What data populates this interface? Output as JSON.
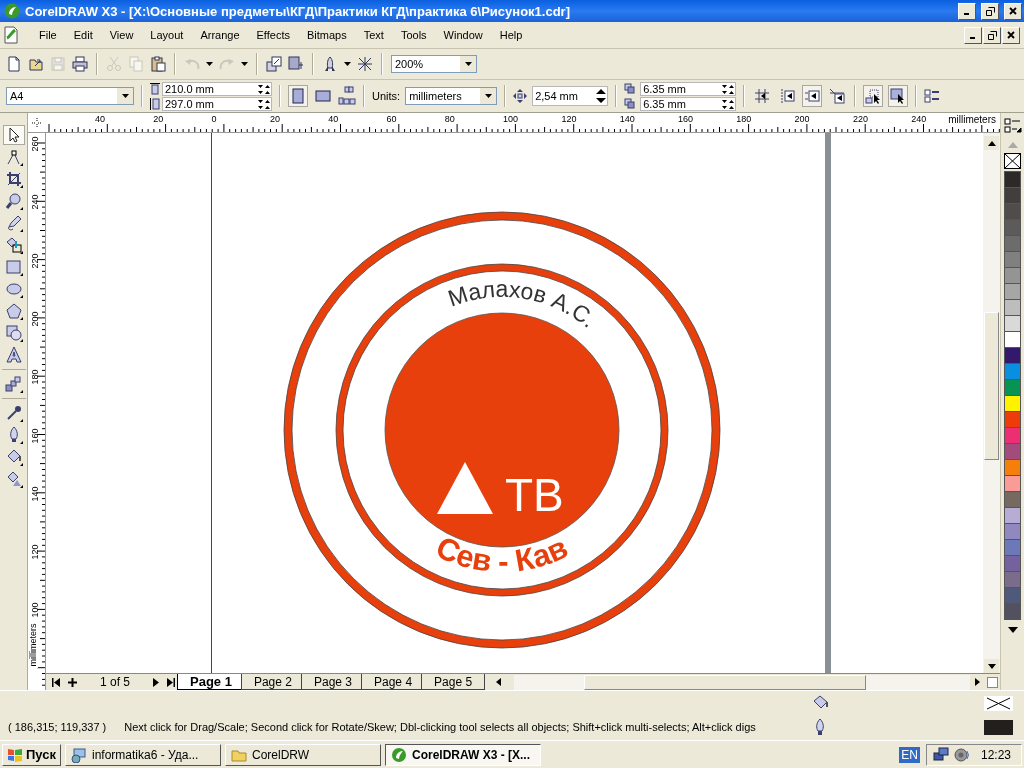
{
  "window": {
    "title": "CorelDRAW X3 - [X:\\Основные предметы\\КГД\\Практики КГД\\практика 6\\Рисунок1.cdr]"
  },
  "menu": [
    "File",
    "Edit",
    "View",
    "Layout",
    "Arrange",
    "Effects",
    "Bitmaps",
    "Text",
    "Tools",
    "Window",
    "Help"
  ],
  "standard_toolbar": [
    {
      "kind": "new",
      "disabled": false
    },
    {
      "kind": "open",
      "disabled": false
    },
    {
      "kind": "save",
      "disabled": true
    },
    {
      "kind": "print",
      "disabled": false
    },
    {
      "kind": "cut",
      "disabled": true
    },
    {
      "kind": "copy",
      "disabled": true
    },
    {
      "kind": "paste",
      "disabled": false
    },
    {
      "kind": "undo",
      "disabled": true
    },
    {
      "kind": "redo",
      "disabled": true
    },
    {
      "kind": "import",
      "disabled": false
    },
    {
      "kind": "export",
      "disabled": false
    },
    {
      "kind": "launcher",
      "disabled": false
    },
    {
      "kind": "connect",
      "disabled": false
    }
  ],
  "zoom": "200%",
  "property_bar": {
    "paper": "A4",
    "width": "210.0 mm",
    "height": "297.0 mm",
    "orientation": [
      {
        "kind": "portrait",
        "selected": true
      },
      {
        "kind": "landscape",
        "selected": false
      }
    ],
    "units_label": "Units:",
    "units": "millimeters",
    "nudge": "2,54 mm",
    "duplicate_x": "6.35 mm",
    "duplicate_y": "6.35 mm",
    "snap": [
      {
        "kind": "grid",
        "selected": false
      },
      {
        "kind": "guidelines",
        "selected": false
      },
      {
        "kind": "objects",
        "selected": true
      },
      {
        "kind": "dynamic",
        "selected": false
      },
      {
        "kind": "treat",
        "selected": true
      },
      {
        "kind": "edit",
        "selected": true
      }
    ]
  },
  "toolbox": [
    {
      "kind": "pick",
      "selected": true
    },
    {
      "kind": "shape",
      "selected": false
    },
    {
      "kind": "crop",
      "selected": false
    },
    {
      "kind": "zoom",
      "selected": false
    },
    {
      "kind": "freehand",
      "selected": false
    },
    {
      "kind": "smartfill",
      "selected": false
    },
    {
      "kind": "rectangle",
      "selected": false
    },
    {
      "kind": "ellipse",
      "selected": false
    },
    {
      "kind": "polygon",
      "selected": false
    },
    {
      "kind": "shapes",
      "selected": false
    },
    {
      "kind": "text",
      "selected": false
    },
    {
      "kind": "blend",
      "selected": false
    },
    {
      "kind": "eyedropper",
      "selected": false
    },
    {
      "kind": "outline",
      "selected": false
    },
    {
      "kind": "fill",
      "selected": false
    },
    {
      "kind": "interactive",
      "selected": false
    }
  ],
  "rulers": {
    "horizontal": [
      "40",
      "20",
      "0",
      "20",
      "40",
      "60",
      "80",
      "100",
      "120",
      "140",
      "160",
      "180",
      "200",
      "220",
      "240"
    ],
    "horizontal_unit": "millimeters",
    "vertical": [
      "260",
      "240",
      "220",
      "200",
      "180",
      "160",
      "140",
      "120",
      "100"
    ],
    "vertical_unit": "millimeters"
  },
  "drawing": {
    "top_text": "Малахов А.С.",
    "center_text": "ТВ",
    "bottom_text": "Сев - Кав"
  },
  "pages": {
    "counter": "1 of 5",
    "tabs": [
      {
        "label": "Page 1",
        "selected": true
      },
      {
        "label": "Page 2",
        "selected": false
      },
      {
        "label": "Page 3",
        "selected": false
      },
      {
        "label": "Page 4",
        "selected": false
      },
      {
        "label": "Page 5",
        "selected": false
      }
    ]
  },
  "palette": [
    {
      "color": "#2b2a26"
    },
    {
      "color": "#403f3d"
    },
    {
      "color": "#4e4d4b"
    },
    {
      "color": "#5c5b59"
    },
    {
      "color": "#6c6c6c"
    },
    {
      "color": "#808080"
    },
    {
      "color": "#949494"
    },
    {
      "color": "#a6a6a6"
    },
    {
      "color": "#bdbdbd"
    },
    {
      "color": "#d9d9d9"
    },
    {
      "color": "#ffffff"
    },
    {
      "color": "#33186b"
    },
    {
      "color": "#0a8fe0"
    },
    {
      "color": "#079351"
    },
    {
      "color": "#fff200"
    },
    {
      "color": "#ed3c0a"
    },
    {
      "color": "#ee2e72"
    },
    {
      "color": "#a24b7c"
    },
    {
      "color": "#f57f0a"
    },
    {
      "color": "#f99c97"
    },
    {
      "color": "#766a60"
    },
    {
      "color": "#b7add4"
    },
    {
      "color": "#9288c0"
    },
    {
      "color": "#6c79b8"
    },
    {
      "color": "#76619f"
    },
    {
      "color": "#7a6d8c"
    },
    {
      "color": "#4f5a7a"
    },
    {
      "color": "#535060"
    }
  ],
  "status": {
    "coordinates": "( 186,315; 119,337 )",
    "message": "Next click for Drag/Scale; Second click for Rotate/Skew; Dbl-clicking tool selects all objects; Shift+click multi-selects; Alt+click digs"
  },
  "taskbar": {
    "start": "Пуск",
    "tasks": [
      {
        "kind": "network",
        "label": "informatika6 - Уда...",
        "selected": false
      },
      {
        "kind": "folder",
        "label": "CorelDRW",
        "selected": false
      },
      {
        "kind": "app",
        "label": "CorelDRAW X3 - [X...",
        "selected": true
      }
    ],
    "language": "EN",
    "clock": "12:23"
  }
}
